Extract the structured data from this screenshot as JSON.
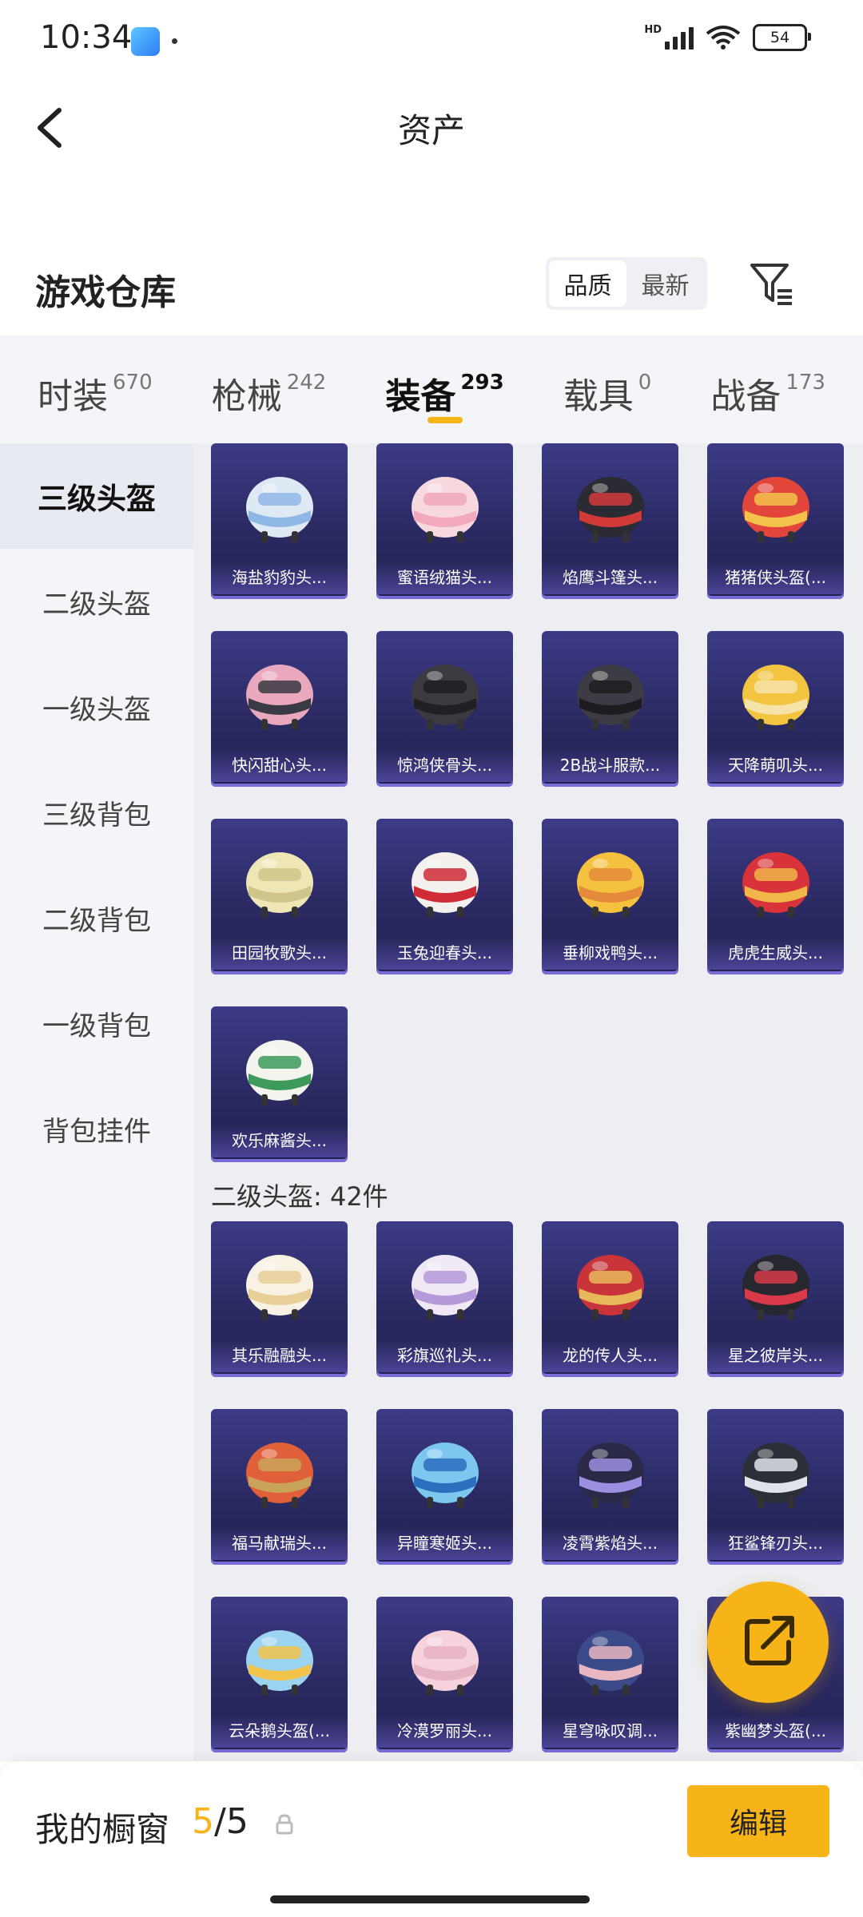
{
  "status_bar": {
    "time": "10:34",
    "network_label": "HD",
    "battery": "54",
    "wifi_label": "6"
  },
  "header": {
    "title": "资产",
    "back_icon": "back-arrow-icon"
  },
  "warehouse": {
    "title": "游戏仓库",
    "sort_options": [
      "品质",
      "最新"
    ],
    "sort_selected": "品质",
    "filter_icon": "filter-icon"
  },
  "tabs": [
    {
      "label": "时装",
      "count": "670"
    },
    {
      "label": "枪械",
      "count": "242"
    },
    {
      "label": "装备",
      "count": "293",
      "active": true
    },
    {
      "label": "载具",
      "count": "0"
    },
    {
      "label": "战备",
      "count": "173"
    }
  ],
  "sidebar": [
    {
      "label": "三级头盔",
      "active": true
    },
    {
      "label": "二级头盔"
    },
    {
      "label": "一级头盔"
    },
    {
      "label": "三级背包"
    },
    {
      "label": "二级背包"
    },
    {
      "label": "一级背包"
    },
    {
      "label": "背包挂件"
    }
  ],
  "groups": [
    {
      "label": "",
      "items": [
        {
          "name": "海盐豹豹头...",
          "colors": [
            "#dfe9f3",
            "#8fb7e6"
          ]
        },
        {
          "name": "蜜语绒猫头...",
          "colors": [
            "#f8d8df",
            "#f2a8bd"
          ]
        },
        {
          "name": "焰鹰斗篷头...",
          "colors": [
            "#2b2b33",
            "#d23a3a"
          ]
        },
        {
          "name": "猪猪侠头盔(...",
          "colors": [
            "#e2463a",
            "#f3c24a"
          ]
        },
        {
          "name": "快闪甜心头...",
          "colors": [
            "#e9a8bd",
            "#3a3a44"
          ]
        },
        {
          "name": "惊鸿侠骨头...",
          "colors": [
            "#3a3a40",
            "#1f1f24"
          ]
        },
        {
          "name": "2B战斗服款...",
          "colors": [
            "#3c3d44",
            "#1c1c21"
          ]
        },
        {
          "name": "天降萌叽头...",
          "colors": [
            "#f2c440",
            "#f6e3a8"
          ]
        },
        {
          "name": "田园牧歌头...",
          "colors": [
            "#efe6b5",
            "#cfc58a"
          ]
        },
        {
          "name": "玉兔迎春头...",
          "colors": [
            "#f3f0ee",
            "#cf2c36"
          ]
        },
        {
          "name": "垂柳戏鸭头...",
          "colors": [
            "#f4c23f",
            "#e58a3a"
          ]
        },
        {
          "name": "虎虎生威头...",
          "colors": [
            "#d8333a",
            "#f1b54a"
          ]
        },
        {
          "name": "欢乐麻酱头...",
          "colors": [
            "#f4f4ef",
            "#3e9a5b"
          ]
        }
      ]
    },
    {
      "label": "二级头盔: 42件",
      "items": [
        {
          "name": "其乐融融头...",
          "colors": [
            "#f7f2e3",
            "#e8cf98"
          ]
        },
        {
          "name": "彩旗巡礼头...",
          "colors": [
            "#f0e8f4",
            "#b49ad8"
          ]
        },
        {
          "name": "龙的传人头...",
          "colors": [
            "#c8343a",
            "#e7b85a"
          ]
        },
        {
          "name": "星之彼岸头...",
          "colors": [
            "#27272f",
            "#d83a4a"
          ]
        },
        {
          "name": "福马献瑞头...",
          "colors": [
            "#e0603a",
            "#c9a35a"
          ]
        },
        {
          "name": "异瞳寒姬头...",
          "colors": [
            "#7cc7ee",
            "#2d6fbf"
          ]
        },
        {
          "name": "凌霄紫焰头...",
          "colors": [
            "#2a2a48",
            "#9a8fe0"
          ]
        },
        {
          "name": "狂鲨锋刃头...",
          "colors": [
            "#2b3038",
            "#dfe3ea"
          ]
        },
        {
          "name": "云朵鹅头盔(...",
          "colors": [
            "#9ad4f0",
            "#f3c44c"
          ]
        },
        {
          "name": "冷漠罗丽头...",
          "colors": [
            "#f6d2dc",
            "#e6b3c2"
          ]
        },
        {
          "name": "星穹咏叹调...",
          "colors": [
            "#3b4a88",
            "#e8b7c2"
          ]
        },
        {
          "name": "紫幽梦头盔(...",
          "colors": [
            "#5a3c8c",
            "#c79ae6"
          ]
        }
      ]
    }
  ],
  "share_button_icon": "share-export-icon",
  "bottom_bar": {
    "label": "我的橱窗",
    "current": "5",
    "separator": "/",
    "total": "5",
    "lock_icon": "lock-icon",
    "edit_label": "编辑"
  },
  "accent_color": "#f6b419"
}
